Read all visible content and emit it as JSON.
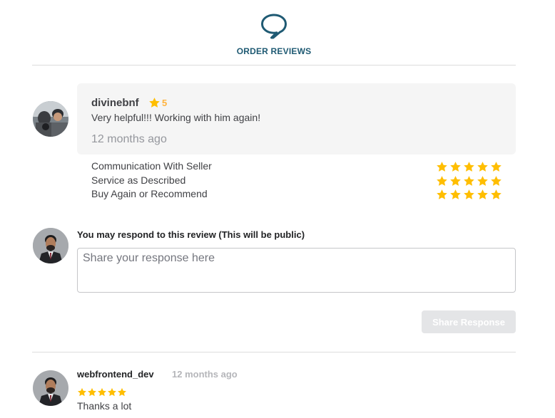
{
  "header": {
    "icon": "chat-bubble-icon",
    "title": "ORDER REVIEWS"
  },
  "review": {
    "avatar": "reviewer-avatar",
    "name": "divinebnf",
    "rating": "5",
    "text": "Very helpful!!! Working with him again!",
    "time": "12 months ago"
  },
  "criteria": [
    {
      "label": "Communication With Seller",
      "stars": 5
    },
    {
      "label": "Service as Described",
      "stars": 5
    },
    {
      "label": "Buy Again or Recommend",
      "stars": 5
    }
  ],
  "respond": {
    "label": "You may respond to this review (This will be public)",
    "placeholder": "Share your response here",
    "button": "Share Response"
  },
  "reply": {
    "avatar": "seller-avatar",
    "name": "webfrontend_dev",
    "time": "12 months ago",
    "stars": 5,
    "text": "Thanks a lot"
  },
  "colors": {
    "accent": "#1f5a73",
    "star": "#ffbe00",
    "card_bg": "#f5f5f5",
    "button_disabled": "#e4e5e7"
  }
}
